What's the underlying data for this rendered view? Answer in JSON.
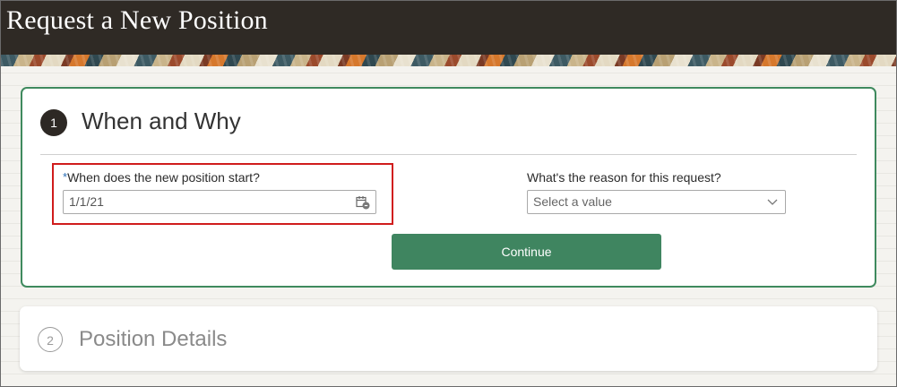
{
  "header": {
    "title": "Request a New Position"
  },
  "sections": [
    {
      "number": "1",
      "title": "When and Why",
      "fields": {
        "start": {
          "required_marker": "*",
          "label": "When does the new position start?",
          "value": "1/1/21",
          "icon": "calendar-icon"
        },
        "reason": {
          "label": "What's the reason for this request?",
          "placeholder": "Select a value",
          "icon": "chevron-down-icon"
        }
      },
      "continue_label": "Continue"
    },
    {
      "number": "2",
      "title": "Position Details"
    }
  ],
  "colors": {
    "header_bg": "#2f2a25",
    "accent_green": "#3f8560",
    "highlight_red": "#d01c1c",
    "required_blue": "#2b6fb7"
  }
}
